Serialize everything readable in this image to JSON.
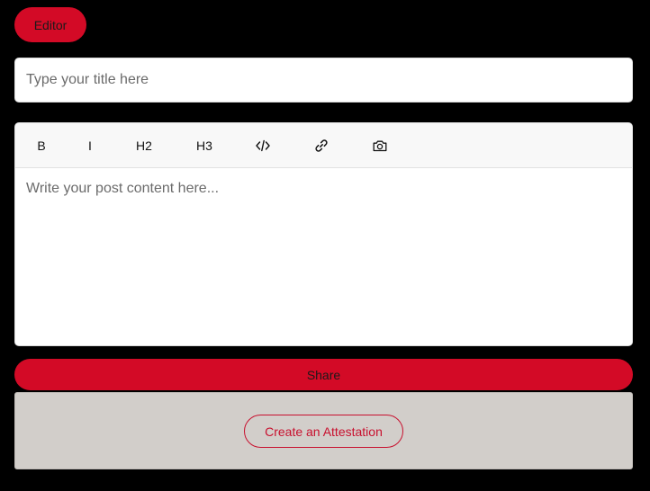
{
  "header": {
    "editor_label": "Editor"
  },
  "title_field": {
    "placeholder": "Type your title here",
    "value": ""
  },
  "toolbar": {
    "bold_label": "B",
    "italic_label": "I",
    "h2_label": "H2",
    "h3_label": "H3",
    "icons": [
      "code-icon",
      "link-icon",
      "camera-icon"
    ]
  },
  "content_field": {
    "placeholder": "Write your post content here...",
    "value": ""
  },
  "actions": {
    "share_label": "Share",
    "attestation_label": "Create an Attestation"
  },
  "colors": {
    "accent": "#d30a26",
    "background": "#000000",
    "attest_panel": "#d2ceca",
    "attest_border": "#c8102e"
  }
}
